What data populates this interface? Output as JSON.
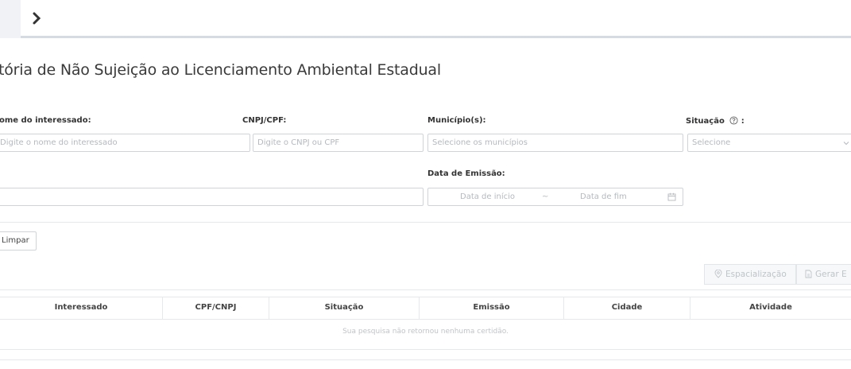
{
  "page": {
    "title": "tória de Não Sujeição ao Licenciamento Ambiental Estadual"
  },
  "filters": {
    "interessado_label": "ome do interessado:",
    "interessado_placeholder": "Digite o nome do interessado",
    "cnpj_label": "CNPJ/CPF:",
    "cnpj_placeholder": "Digite o CNPJ ou CPF",
    "municipio_label": "Município(s):",
    "municipio_placeholder": "Selecione os municípios",
    "situacao_label": "Situação",
    "situacao_suffix": ":",
    "situacao_placeholder": "Selecione",
    "data_label": "Data de Emissão:",
    "data_inicio_placeholder": "Data de início",
    "data_separator": "~",
    "data_fim_placeholder": "Data de fim"
  },
  "actions": {
    "clear_label": "Limpar",
    "spatial_label": "Espacialização",
    "generate_label": "Gerar E"
  },
  "table": {
    "columns": [
      "Interessado",
      "CPF/CNPJ",
      "Situação",
      "Emissão",
      "Cidade",
      "Atividade"
    ],
    "empty_message": "Sua pesquisa não retornou nenhuma certidão."
  },
  "icons": {
    "nav": "chevron-right-icon",
    "situacao_help": "help-circle-icon",
    "select_arrow": "chevron-down-icon",
    "calendar": "calendar-icon",
    "spatial": "map-pin-icon",
    "generate": "document-icon"
  },
  "colors": {
    "border": "#cfd4d9",
    "placeholder": "#b4b9be",
    "disabled_text": "#bfc4c9"
  }
}
